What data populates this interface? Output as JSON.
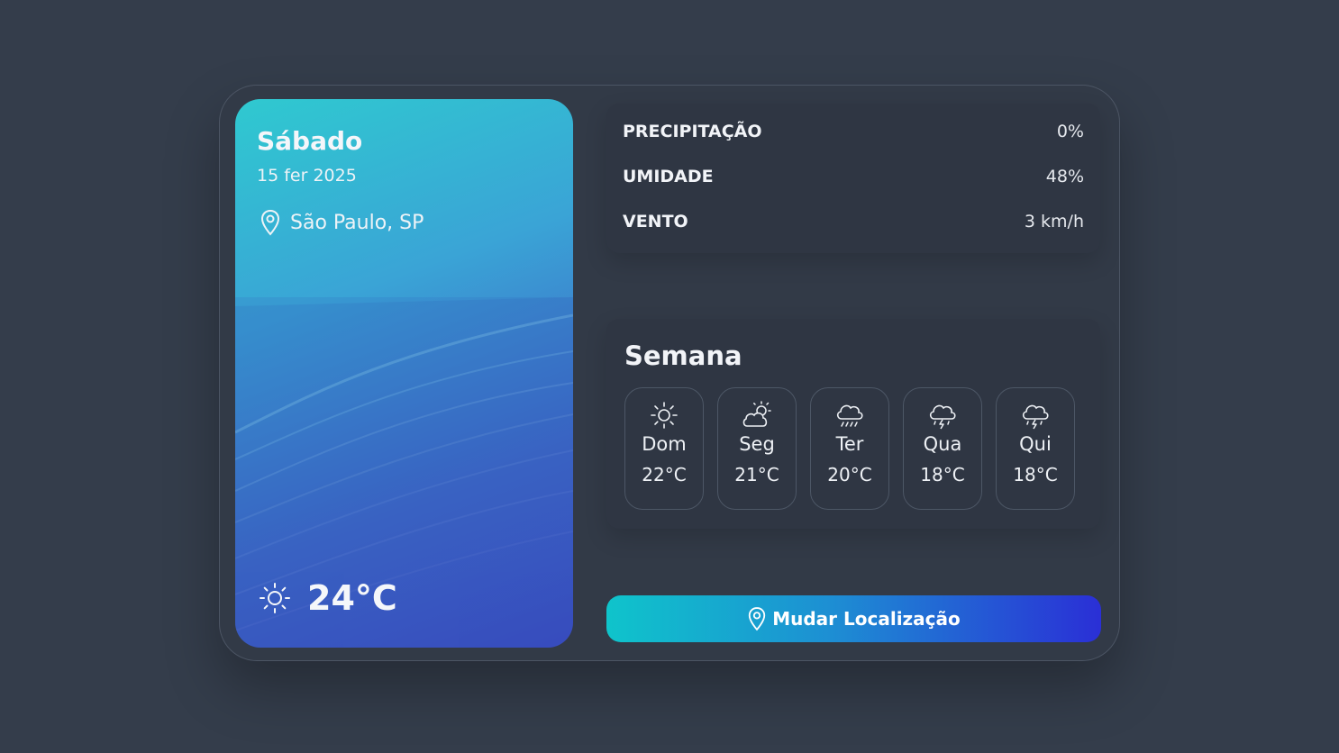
{
  "hero": {
    "day": "Sábado",
    "date": "15 fer 2025",
    "location": "São Paulo, SP",
    "location_icon": "map-pin-icon",
    "condition_icon": "sun-icon",
    "temperature": "24°C"
  },
  "stats": [
    {
      "label": "PRECIPITAÇÃO",
      "value": "0%"
    },
    {
      "label": "UMIDADE",
      "value": "48%"
    },
    {
      "label": "VENTO",
      "value": "3 km/h"
    }
  ],
  "week": {
    "title": "Semana",
    "days": [
      {
        "name": "Dom",
        "temp": "22°C",
        "icon": "sun-icon"
      },
      {
        "name": "Seg",
        "temp": "21°C",
        "icon": "partly-cloudy-icon"
      },
      {
        "name": "Ter",
        "temp": "20°C",
        "icon": "rain-icon"
      },
      {
        "name": "Qua",
        "temp": "18°C",
        "icon": "thunderstorm-icon"
      },
      {
        "name": "Qui",
        "temp": "18°C",
        "icon": "thunderstorm-icon"
      }
    ]
  },
  "button": {
    "label": "Mudar Localização",
    "icon": "map-pin-icon"
  },
  "colors": {
    "background": "#343d4b",
    "card": "#323a47",
    "panel": "#2f3643",
    "gradient_start": "#0fc4cb",
    "gradient_end": "#2a2fd6"
  }
}
